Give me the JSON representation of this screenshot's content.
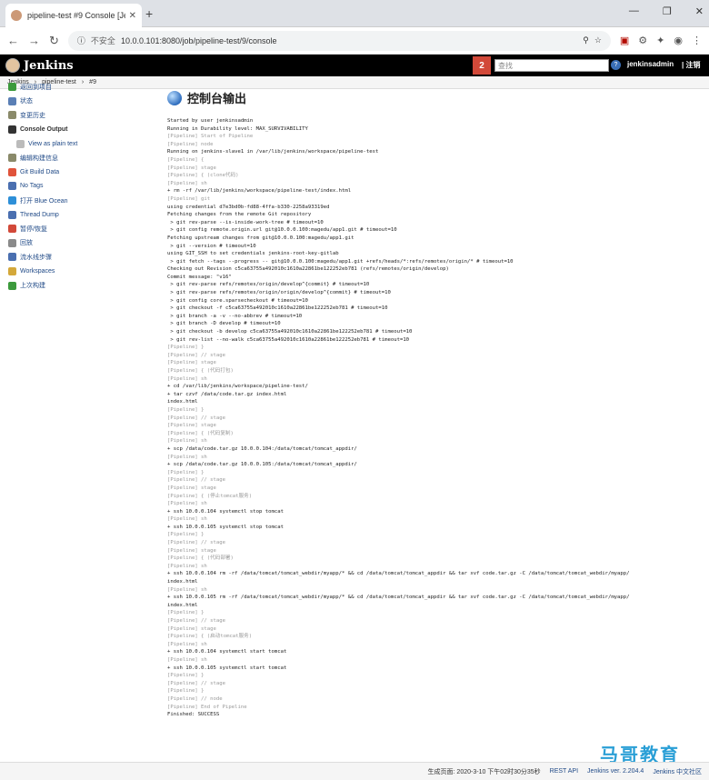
{
  "browser": {
    "tab_title": "pipeline-test #9 Console [Jenk",
    "security_label": "不安全",
    "url": "10.0.0.101:8080/job/pipeline-test/9/console"
  },
  "header": {
    "logo_text": "Jenkins",
    "notification_count": "2",
    "search_placeholder": "查找",
    "user": "jenkinsadmin",
    "logout": "| 注销"
  },
  "breadcrumb": [
    "Jenkins",
    "pipeline-test",
    "#9"
  ],
  "sidebar": [
    {
      "label": "返回到项目",
      "icon": "up-arrow-icon",
      "color": "#3c9a3c"
    },
    {
      "label": "状态",
      "icon": "search-icon",
      "color": "#5a7fb5"
    },
    {
      "label": "变更历史",
      "icon": "notepad-icon",
      "color": "#8a8a6a"
    },
    {
      "label": "Console Output",
      "icon": "terminal-icon",
      "color": "#333333",
      "active": true
    },
    {
      "label": "View as plain text",
      "icon": "document-icon",
      "color": "#bbbbbb",
      "sub": true
    },
    {
      "label": "编辑构建信息",
      "icon": "notepad-icon",
      "color": "#8a8a6a"
    },
    {
      "label": "Git Build Data",
      "icon": "git-icon",
      "color": "#e0533b"
    },
    {
      "label": "No Tags",
      "icon": "tag-icon",
      "color": "#4a6fb0"
    },
    {
      "label": "打开 Blue Ocean",
      "icon": "blue-ocean-icon",
      "color": "#2d8fd8"
    },
    {
      "label": "Thread Dump",
      "icon": "thread-icon",
      "color": "#4a6fb0"
    },
    {
      "label": "暂停/恢复",
      "icon": "pause-icon",
      "color": "#d24939"
    },
    {
      "label": "回放",
      "icon": "replay-icon",
      "color": "#8a8a8a"
    },
    {
      "label": "流水线步骤",
      "icon": "steps-icon",
      "color": "#4a6fb0"
    },
    {
      "label": "Workspaces",
      "icon": "folder-icon",
      "color": "#d4a83a"
    },
    {
      "label": "上次构建",
      "icon": "previous-build-icon",
      "color": "#3c9a3c"
    }
  ],
  "main": {
    "title": "控制台输出",
    "console_lines": [
      "Started by user jenkinsadmin",
      "Running in Durability level: MAX_SURVIVABILITY",
      "[Pipeline] Start of Pipeline",
      "[Pipeline] node",
      "Running on jenkins-slave1 in /var/lib/jenkins/workspace/pipeline-test",
      "[Pipeline] {",
      "[Pipeline] stage",
      "[Pipeline] { (clone代码)",
      "[Pipeline] sh",
      "+ rm -rf /var/lib/jenkins/workspace/pipeline-test/index.html",
      "[Pipeline] git",
      "using credential d7e3bd0b-fd88-4ffa-b330-2258a93319ed",
      "Fetching changes from the remote Git repository",
      " > git rev-parse --is-inside-work-tree # timeout=10",
      " > git config remote.origin.url git@10.0.0.100:magedu/app1.git # timeout=10",
      "Fetching upstream changes from git@10.0.0.100:magedu/app1.git",
      " > git --version # timeout=10",
      "using GIT_SSH to set credentials jenkins-root-key-gitlab",
      " > git fetch --tags --progress -- git@10.0.0.100:magedu/app1.git +refs/heads/*:refs/remotes/origin/* # timeout=10",
      "Checking out Revision c5ca63755a492010c1610a22861be122252eb781 (refs/remotes/origin/develop)",
      "Commit message: \"v16\"",
      " > git rev-parse refs/remotes/origin/develop^{commit} # timeout=10",
      " > git rev-parse refs/remotes/origin/origin/develop^{commit} # timeout=10",
      " > git config core.sparsecheckout # timeout=10",
      " > git checkout -f c5ca63755a492010c1610a22861be122252eb781 # timeout=10",
      " > git branch -a -v --no-abbrev # timeout=10",
      " > git branch -D develop # timeout=10",
      " > git checkout -b develop c5ca63755a492010c1610a22861be122252eb781 # timeout=10",
      " > git rev-list --no-walk c5ca63755a492010c1610a22861be122252eb781 # timeout=10",
      "[Pipeline] }",
      "[Pipeline] // stage",
      "[Pipeline] stage",
      "[Pipeline] { (代码打包)",
      "[Pipeline] sh",
      "+ cd /var/lib/jenkins/workspace/pipeline-test/",
      "+ tar czvf /data/code.tar.gz index.html",
      "index.html",
      "[Pipeline] }",
      "[Pipeline] // stage",
      "[Pipeline] stage",
      "[Pipeline] { (代码复制)",
      "[Pipeline] sh",
      "+ scp /data/code.tar.gz 10.0.0.104:/data/tomcat/tomcat_appdir/",
      "[Pipeline] sh",
      "+ scp /data/code.tar.gz 10.0.0.105:/data/tomcat/tomcat_appdir/",
      "[Pipeline] }",
      "[Pipeline] // stage",
      "[Pipeline] stage",
      "[Pipeline] { (停止tomcat服务)",
      "[Pipeline] sh",
      "+ ssh 10.0.0.104 systemctl stop tomcat",
      "[Pipeline] sh",
      "+ ssh 10.0.0.105 systemctl stop tomcat",
      "[Pipeline] }",
      "[Pipeline] // stage",
      "[Pipeline] stage",
      "[Pipeline] { (代码部署)",
      "[Pipeline] sh",
      "+ ssh 10.0.0.104 rm -rf /data/tomcat/tomcat_webdir/myapp/* && cd /data/tomcat/tomcat_appdir && tar xvf code.tar.gz -C /data/tomcat/tomcat_webdir/myapp/",
      "index.html",
      "[Pipeline] sh",
      "+ ssh 10.0.0.105 rm -rf /data/tomcat/tomcat_webdir/myapp/* && cd /data/tomcat/tomcat_appdir && tar xvf code.tar.gz -C /data/tomcat/tomcat_webdir/myapp/",
      "index.html",
      "[Pipeline] }",
      "[Pipeline] // stage",
      "[Pipeline] stage",
      "[Pipeline] { (启动tomcat服务)",
      "[Pipeline] sh",
      "+ ssh 10.0.0.104 systemctl start tomcat",
      "[Pipeline] sh",
      "+ ssh 10.0.0.105 systemctl start tomcat",
      "[Pipeline] }",
      "[Pipeline] // stage",
      "[Pipeline] }",
      "[Pipeline] // node",
      "[Pipeline] End of Pipeline",
      "Finished: SUCCESS"
    ]
  },
  "footer": {
    "generated": "生成页面: 2020-3-10 下午02时30分35秒",
    "rest_api": "REST API",
    "version": "Jenkins ver. 2.204.4",
    "community": "Jenkins 中文社区"
  },
  "watermark": "马哥教育"
}
